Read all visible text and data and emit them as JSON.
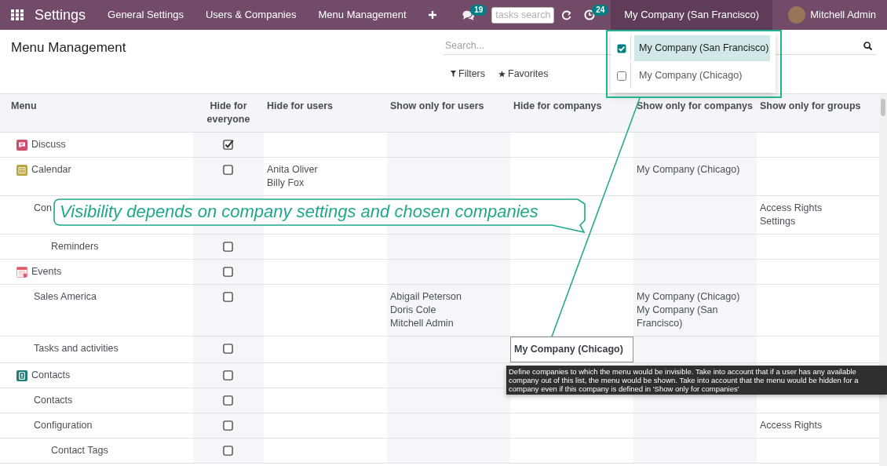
{
  "top_bar": {
    "app_title": "Settings",
    "nav": [
      {
        "label": "General Settings"
      },
      {
        "label": "Users & Companies"
      },
      {
        "label": "Menu Management"
      }
    ],
    "messages_count": "19",
    "tasks_search": {
      "placeholder": "tasks search"
    },
    "activities_count": "24",
    "company": "My Company (San Francisco)",
    "user": "Mitchell Admin"
  },
  "company_dropdown": {
    "items": [
      {
        "label": "My Company (San Francisco)",
        "checked": true,
        "selected": true
      },
      {
        "label": "My Company (Chicago)",
        "checked": false,
        "selected": false
      }
    ]
  },
  "control_panel": {
    "title": "Menu Management",
    "search": {
      "placeholder": "Search..."
    },
    "filters": "Filters",
    "favorites": "Favorites"
  },
  "table": {
    "columns": [
      "Menu",
      "Hide for everyone",
      "Hide for users",
      "Show only for users",
      "Hide for companys",
      "Show only for companys",
      "Show only for groups"
    ],
    "rows": [
      {
        "menu": "Discuss",
        "hide_for_everyone": true,
        "editing": false
      },
      {
        "menu": "Calendar",
        "hide_for_everyone": false,
        "hide_for_users": [
          "Anita Oliver",
          "Billy Fox"
        ],
        "show_only_for_companys": [
          "My Company (Chicago)"
        ],
        "editing": false,
        "children": [
          {
            "menu": "Con",
            "show_only_for_groups": [
              "Access Rights",
              "Settings"
            ],
            "editing": false,
            "children": [
              {
                "menu": "Reminders",
                "hide_for_everyone": false,
                "editing": false
              }
            ]
          }
        ]
      },
      {
        "menu": "Events",
        "hide_for_everyone": false,
        "editing": false,
        "children": [
          {
            "menu": "Sales America",
            "hide_for_everyone": false,
            "show_only_for_users": [
              "Abigail Peterson",
              "Doris Cole",
              "Mitchell Admin"
            ],
            "show_only_for_companys": [
              "My Company (Chicago)",
              "My Company (San Francisco)"
            ],
            "editing": false
          },
          {
            "menu": "Tasks and activities",
            "hide_for_everyone": false,
            "hide_for_companys": [
              "My Company (Chicago)"
            ],
            "editing": true
          }
        ]
      },
      {
        "menu": "Contacts",
        "hide_for_everyone": false,
        "editing": false,
        "children": [
          {
            "menu": "Contacts",
            "hide_for_everyone": false,
            "editing": false
          },
          {
            "menu": "Configuration",
            "hide_for_everyone": false,
            "show_only_for_groups": [
              "Access Rights"
            ],
            "editing": false,
            "children": [
              {
                "menu": "Contact Tags",
                "hide_for_everyone": false,
                "editing": false
              }
            ]
          }
        ]
      }
    ]
  },
  "callout": {
    "text": "Visibility depends on company settings and chosen companies"
  },
  "tooltip": {
    "text": "Define companies to which the menu would be invisible. Take into account that if a user has any available company out of this list, the menu would be shown. Take into account that the menu would be hidden for a company even if this company is defined in 'Show only for companies'"
  }
}
